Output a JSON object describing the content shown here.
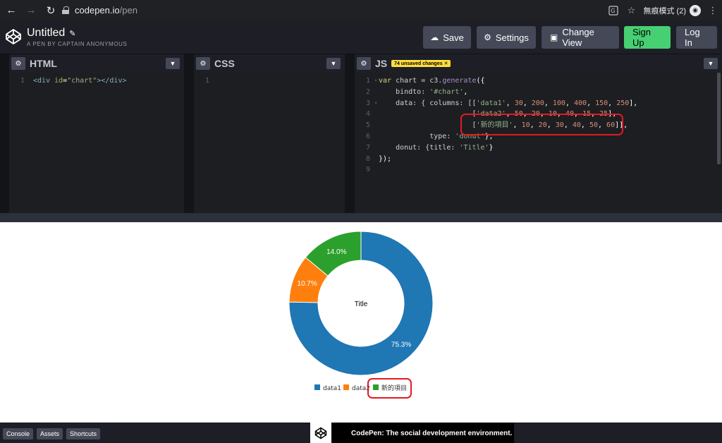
{
  "browser": {
    "url_host": "codepen.io",
    "url_path": "/pen",
    "incognito_label": "無痕模式 (2)"
  },
  "header": {
    "title": "Untitled",
    "subtitle": "A PEN BY CAPTAIN ANONYMOUS",
    "save_label": "Save",
    "settings_label": "Settings",
    "change_view_label": "Change View",
    "signup_label": "Sign Up",
    "login_label": "Log In"
  },
  "editors": {
    "html": {
      "name": "HTML",
      "lines": [
        "1"
      ],
      "code_line_1": [
        "<div ",
        "id",
        "=",
        "\"chart\"",
        "></div>"
      ]
    },
    "css": {
      "name": "CSS",
      "lines": [
        "1"
      ]
    },
    "js": {
      "name": "JS",
      "unsaved_badge": "74 unsaved changes",
      "line_numbers": [
        "1",
        "2",
        "3",
        "4",
        "5",
        "6",
        "7",
        "8",
        "9"
      ]
    }
  },
  "chart_data": {
    "type": "pie",
    "donut_title": "Title",
    "categories": [
      "data1",
      "data2",
      "新的項目"
    ],
    "values": [
      75.3,
      10.7,
      14.0
    ],
    "labels": [
      "75.3%",
      "10.7%",
      "14.0%"
    ],
    "colors": [
      "#1f77b4",
      "#ff7f0e",
      "#2ca02c"
    ]
  },
  "footer": {
    "console_label": "Console",
    "assets_label": "Assets",
    "shortcuts_label": "Shortcuts",
    "promo_text": "CodePen: The social development environment."
  },
  "colors": {
    "accent_green": "#47cf73",
    "highlight_red": "#e01b22",
    "badge_yellow": "#ffdd40"
  }
}
